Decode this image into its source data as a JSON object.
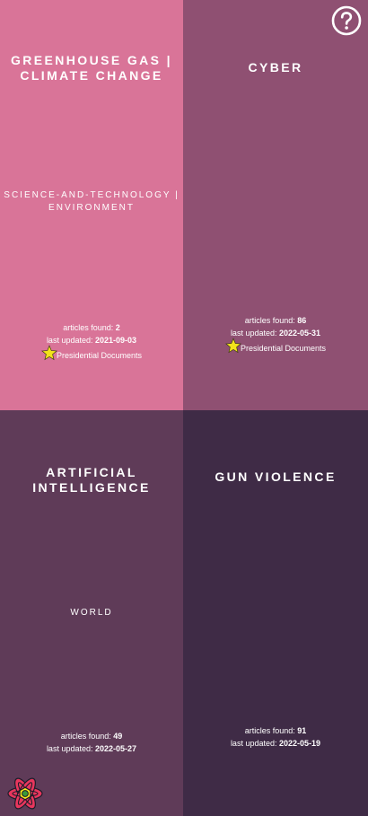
{
  "help": {
    "icon": "question-circle-icon"
  },
  "logo": {
    "icon": "react-atom-logo"
  },
  "labels": {
    "articles_found": "articles found:",
    "last_updated": "last updated:"
  },
  "topics": [
    {
      "title": "GREENHOUSE GAS | CLIMATE CHANGE",
      "subtitle": "SCIENCE-AND-TECHNOLOGY | ENVIRONMENT",
      "articles_found": "2",
      "last_updated": "2021-09-03",
      "badge": "Presidential Documents",
      "color": "#d97498"
    },
    {
      "title": "CYBER",
      "subtitle": "",
      "articles_found": "86",
      "last_updated": "2022-05-31",
      "badge": "Presidential Documents",
      "color": "#8f5072"
    },
    {
      "title": "ARTIFICIAL INTELLIGENCE",
      "subtitle": "WORLD",
      "articles_found": "49",
      "last_updated": "2022-05-27",
      "badge": "",
      "color": "#5f3b58"
    },
    {
      "title": "GUN VIOLENCE",
      "subtitle": "",
      "articles_found": "91",
      "last_updated": "2022-05-19",
      "badge": "",
      "color": "#3f2b46"
    }
  ]
}
